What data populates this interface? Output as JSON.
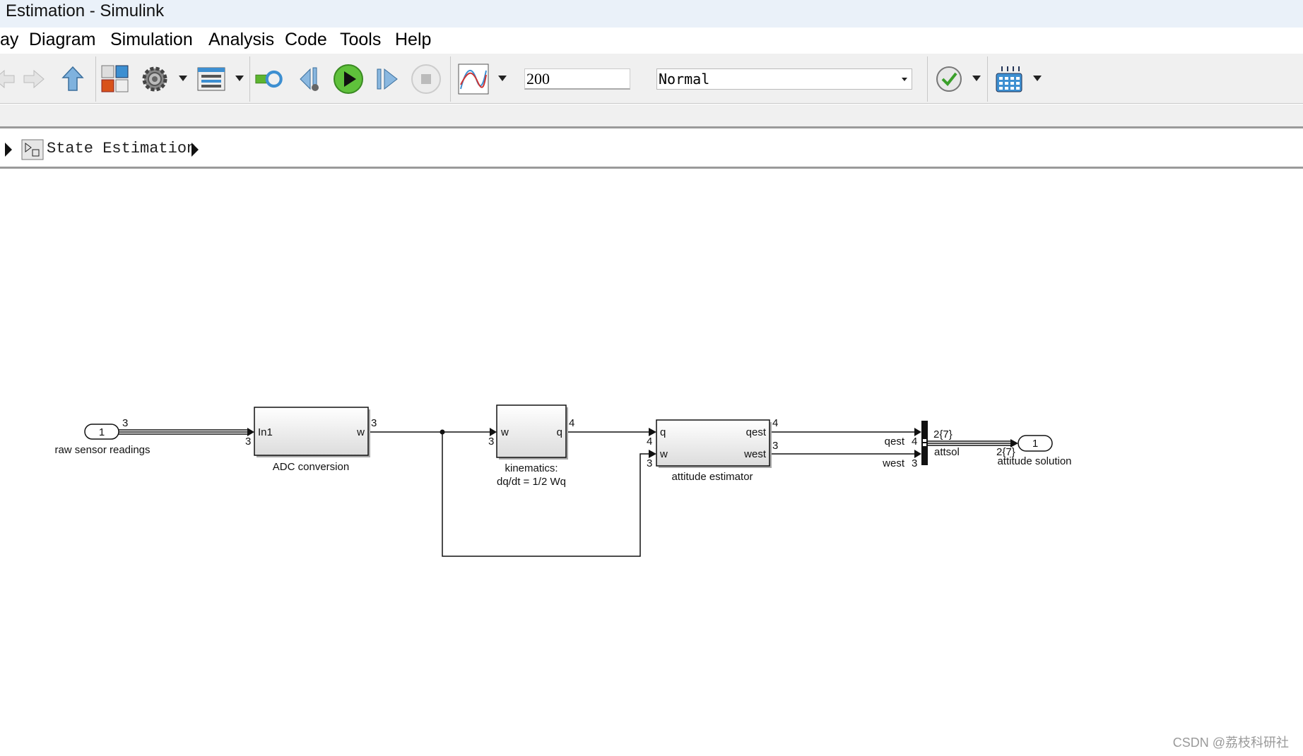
{
  "window": {
    "title": "Estimation - Simulink"
  },
  "menu": [
    "ay",
    "Diagram",
    "Simulation",
    "Analysis",
    "Code",
    "Tools",
    "Help"
  ],
  "toolbar": {
    "icons": [
      "back-arrow-icon",
      "forward-arrow-icon",
      "up-arrow-icon",
      "library-browser-icon",
      "model-settings-gear-icon",
      "model-explorer-icon",
      "record-loop-icon",
      "step-back-icon",
      "run-icon",
      "step-forward-icon",
      "stop-icon",
      "scope-icon",
      "model-advisor-check-icon",
      "build-grid-icon"
    ],
    "stop_time": "200",
    "sim_mode": "Normal",
    "run_color": "#3fae2a"
  },
  "breadcrumb": {
    "label": "State Estimation"
  },
  "diagram": {
    "inport": {
      "number": "1",
      "label": "raw sensor readings",
      "width": "3"
    },
    "adc": {
      "in": "In1",
      "out": "w",
      "label": "ADC conversion",
      "in_dim": "3",
      "out_dim": "3"
    },
    "kinematics": {
      "in": "w",
      "out": "q",
      "label1": "kinematics:",
      "label2": "dq/dt = 1/2 Wq",
      "in_dim": "3",
      "out_dim": "4"
    },
    "estimator": {
      "in1": "q",
      "in2": "w",
      "out1": "qest",
      "out2": "west",
      "label": "attitude estimator",
      "in1_dim": "4",
      "in2_dim": "3",
      "out1_dim": "4",
      "out2_dim": "3"
    },
    "bus": {
      "sig1": "qest",
      "sig2": "west",
      "dim1": "4",
      "dim2": "3",
      "out_dim": "2{7}",
      "name": "attsol"
    },
    "outport": {
      "number": "1",
      "label": "attitude solution",
      "dim": "2{7}"
    }
  },
  "watermark": "CSDN @荔枝科研社"
}
